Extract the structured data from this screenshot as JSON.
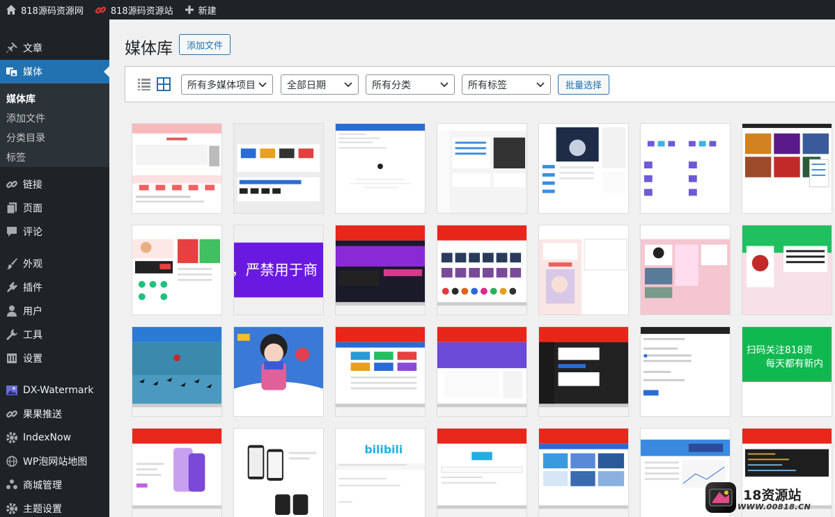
{
  "adminbar": {
    "items": [
      {
        "label": "818源码资源网",
        "icon": "home-icon"
      },
      {
        "label": "818源码资源站",
        "icon": "link-icon"
      },
      {
        "label": "新建",
        "icon": "plus-icon"
      }
    ]
  },
  "sidebar": {
    "items": [
      {
        "label": "文章",
        "icon": "pin-icon"
      },
      {
        "label": "媒体",
        "icon": "media-icon",
        "current": true
      },
      {
        "label": "链接",
        "icon": "link-icon"
      },
      {
        "label": "页面",
        "icon": "pages-icon"
      },
      {
        "label": "评论",
        "icon": "comment-icon"
      },
      {
        "label": "外观",
        "icon": "brush-icon"
      },
      {
        "label": "插件",
        "icon": "plugin-icon"
      },
      {
        "label": "用户",
        "icon": "user-icon"
      },
      {
        "label": "工具",
        "icon": "wrench-icon"
      },
      {
        "label": "设置",
        "icon": "settings-icon"
      },
      {
        "label": "DX-Watermark",
        "icon": "image-icon"
      },
      {
        "label": "果果推送",
        "icon": "link-icon"
      },
      {
        "label": "IndexNow",
        "icon": "gear-icon"
      },
      {
        "label": "WP泡网站地图",
        "icon": "globe-icon"
      },
      {
        "label": "商城管理",
        "icon": "group-icon"
      },
      {
        "label": "主题设置",
        "icon": "gear-icon"
      }
    ],
    "submenu": [
      {
        "label": "媒体库",
        "current": true
      },
      {
        "label": "添加文件"
      },
      {
        "label": "分类目录"
      },
      {
        "label": "标签"
      }
    ]
  },
  "main": {
    "title": "媒体库",
    "add_button": "添加文件",
    "filters": {
      "media_type": "所有多媒体项目",
      "date": "全部日期",
      "category": "所有分类",
      "tag": "所有标签"
    },
    "bulk_button": "批量选择",
    "view_modes": [
      "list-view-icon",
      "grid-view-icon"
    ]
  },
  "grid_tiles": [
    {
      "thumb": "web-page-red-buttons"
    },
    {
      "thumb": "template-gallery"
    },
    {
      "thumb": "blue-header-doc"
    },
    {
      "thumb": "dashboard-panels"
    },
    {
      "thumb": "mobile-app-galaxy"
    },
    {
      "thumb": "icon-grid-purple"
    },
    {
      "thumb": "anime-wallpapers"
    },
    {
      "thumb": "profile-app"
    },
    {
      "thumb": "purple-banner-text"
    },
    {
      "thumb": "laptop-purple-site"
    },
    {
      "thumb": "laptop-app-icons"
    },
    {
      "thumb": "anime-pink-card"
    },
    {
      "thumb": "anime-teal-site"
    },
    {
      "thumb": "green-anime-banner"
    },
    {
      "thumb": "laptop-birds-lake"
    },
    {
      "thumb": "girl-book-illustration"
    },
    {
      "thumb": "laptop-admin-blue"
    },
    {
      "thumb": "laptop-purple-blog"
    },
    {
      "thumb": "laptop-dark-admin"
    },
    {
      "thumb": "settings-dialog"
    },
    {
      "thumb": "green-qr-banner"
    },
    {
      "thumb": "laptop-phone-mockups"
    },
    {
      "thumb": "phone-mockups-white"
    },
    {
      "thumb": "bilibili-page"
    },
    {
      "thumb": "laptop-bilibili"
    },
    {
      "thumb": "laptop-wallpaper-grid"
    },
    {
      "thumb": "laptop-blue-dashboard"
    },
    {
      "thumb": "laptop-code-editor"
    }
  ],
  "grid_banner_texts": {
    "purple": "，严禁用于商",
    "green_1": "扫码关注818资",
    "green_2": "每天都有新内",
    "bilibili": "bilibili"
  },
  "watermark": {
    "name": "18资源站",
    "url": "WWW.00818.CN"
  }
}
